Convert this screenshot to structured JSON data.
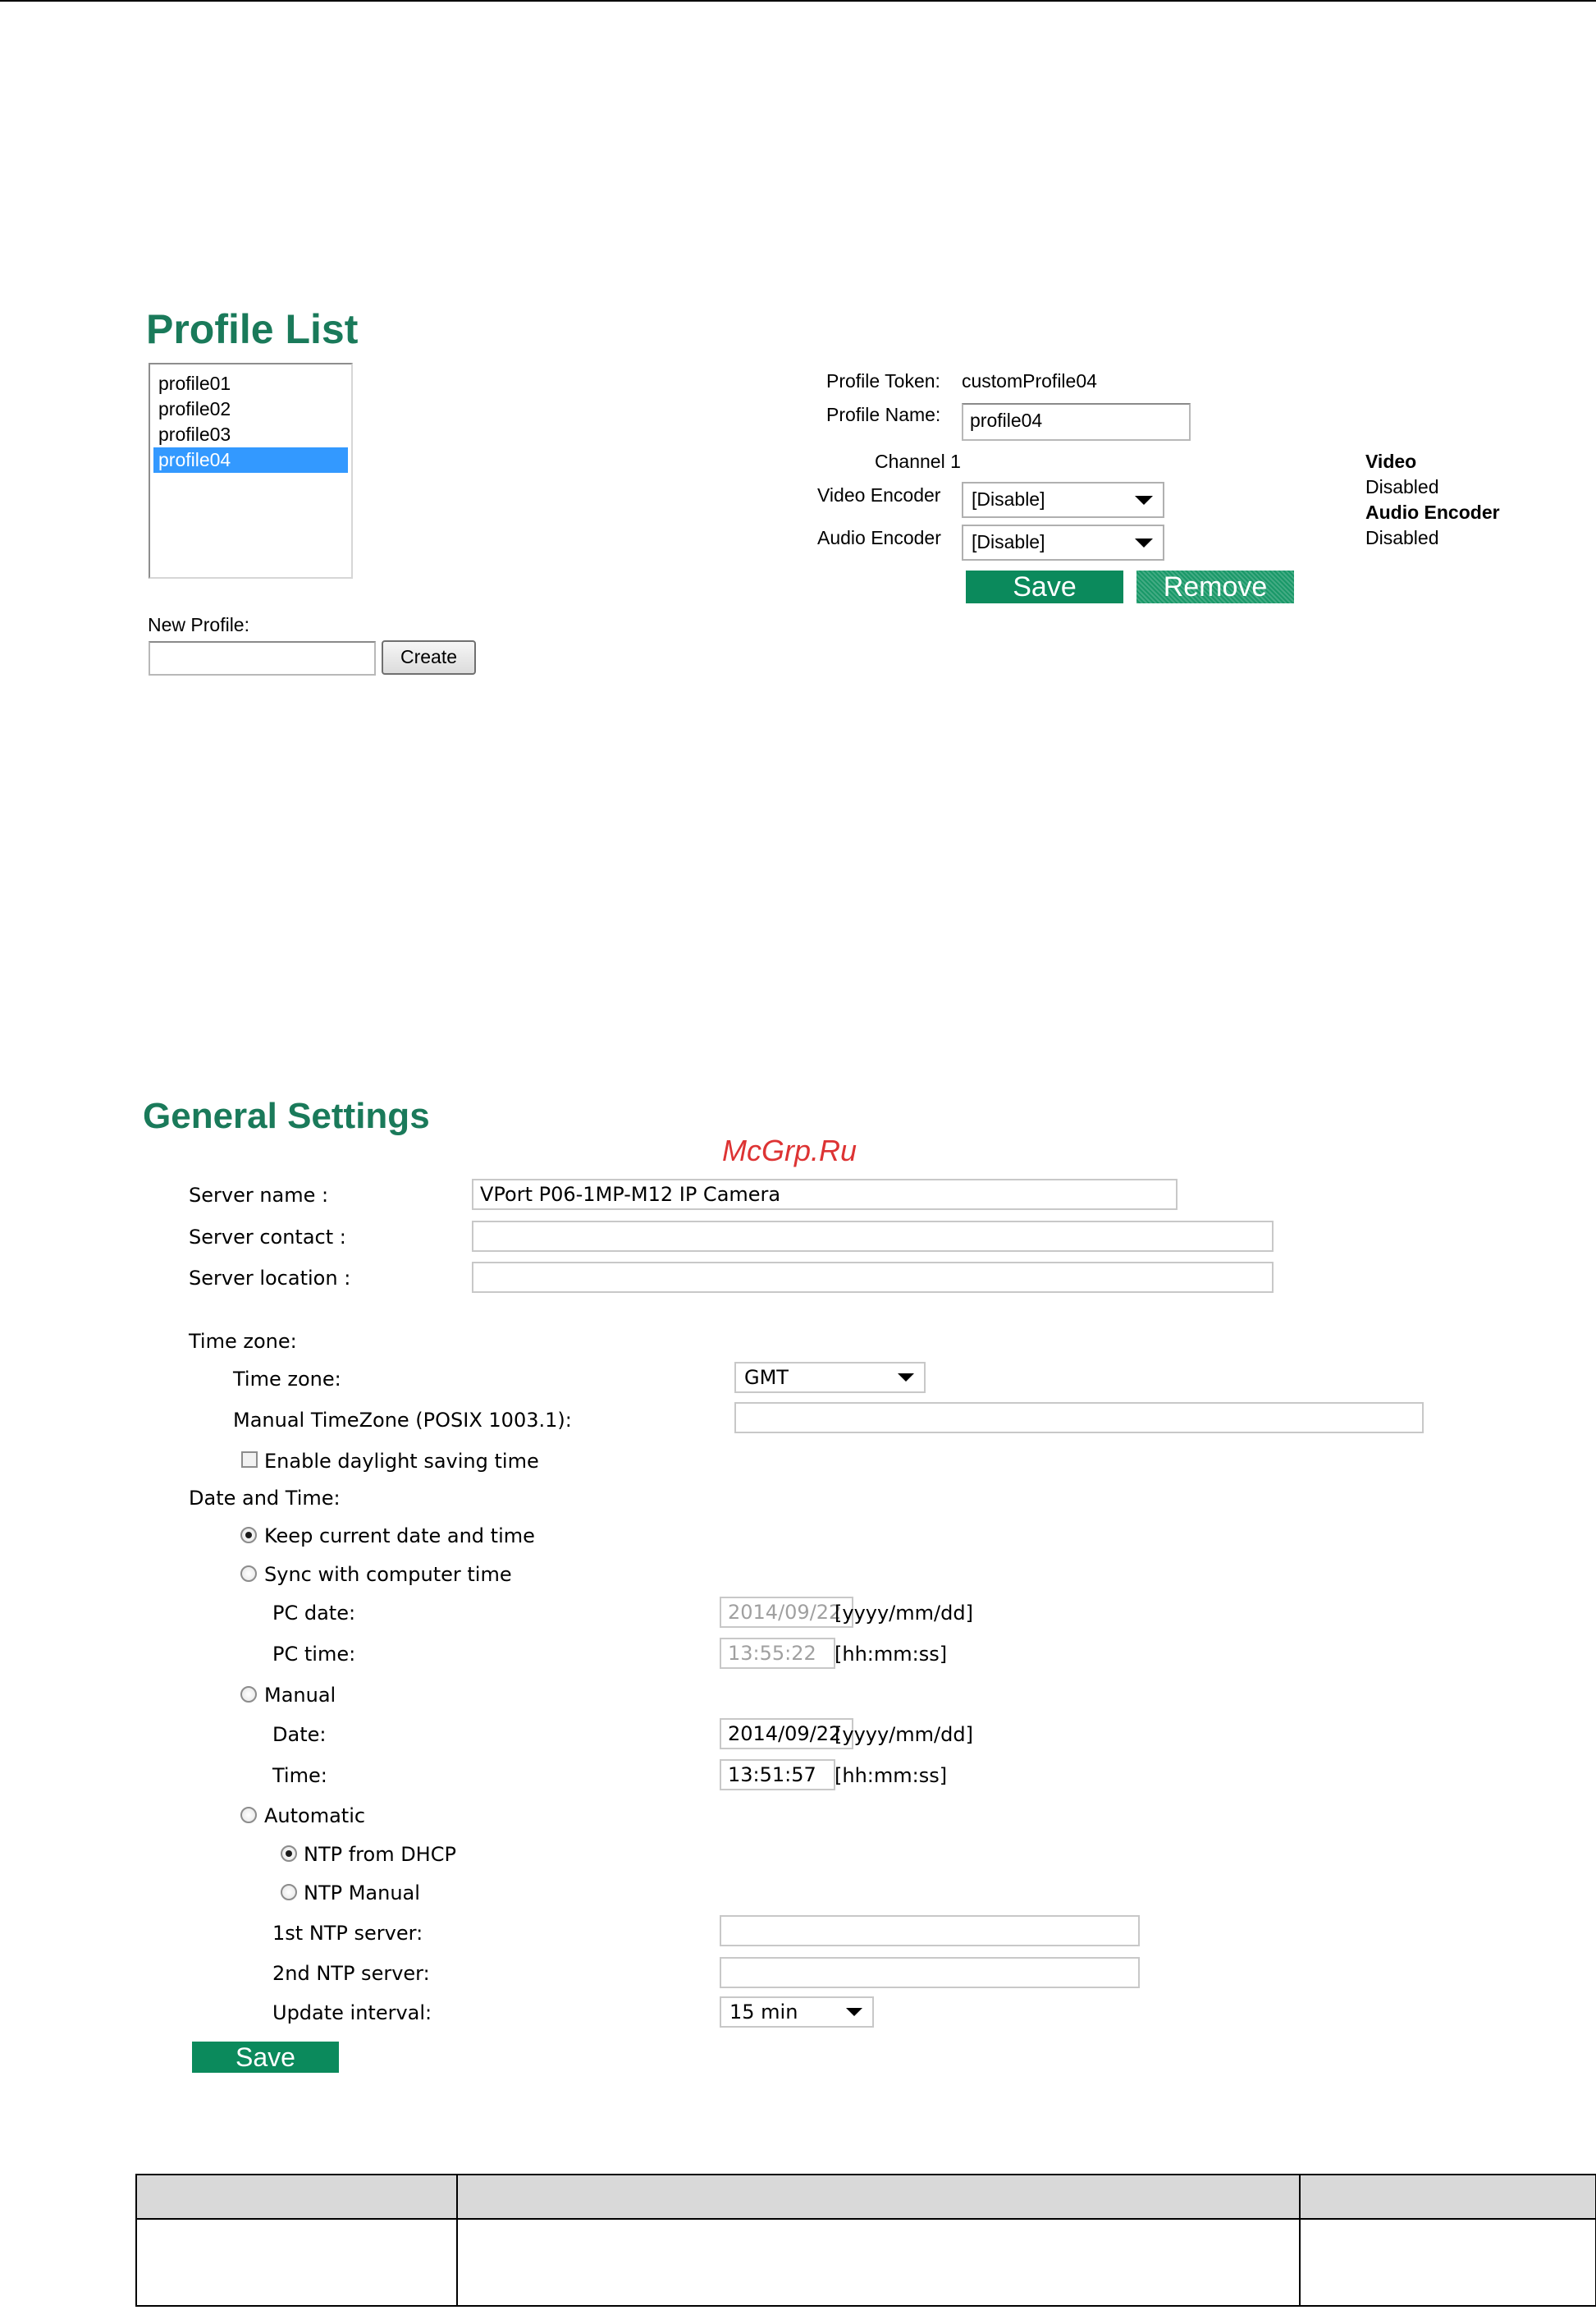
{
  "profile_section": {
    "title": "Profile List",
    "profiles": [
      "profile01",
      "profile02",
      "profile03",
      "profile04"
    ],
    "selected_profile": "profile04",
    "new_profile_label": "New Profile:",
    "new_profile_value": "",
    "create_label": "Create",
    "token_label": "Profile Token:",
    "token_value": "customProfile04",
    "name_label": "Profile Name:",
    "name_value": "profile04",
    "channel_label": "Channel 1",
    "video_encoder_label": "Video Encoder",
    "video_encoder_value": "[Disable]",
    "audio_encoder_label": "Audio Encoder",
    "audio_encoder_value": "[Disable]",
    "save_label": "Save",
    "remove_label": "Remove",
    "summary": {
      "video_heading": "Video",
      "video_value": "Disabled",
      "audio_heading": "Audio Encoder",
      "audio_value": "Disabled"
    }
  },
  "watermark": "McGrp.Ru",
  "general_settings": {
    "title": "General Settings",
    "server_name_label": "Server name :",
    "server_name_value": "VPort P06-1MP-M12 IP Camera",
    "server_contact_label": "Server contact :",
    "server_contact_value": "",
    "server_location_label": "Server location :",
    "server_location_value": "",
    "time_zone_heading": "Time zone:",
    "time_zone_label": "Time zone:",
    "time_zone_value": "GMT",
    "manual_tz_label": "Manual TimeZone (POSIX 1003.1):",
    "manual_tz_value": "",
    "dst_label": "Enable daylight saving time",
    "dst_checked": false,
    "date_time_heading": "Date and Time:",
    "keep_current_label": "Keep current date and time",
    "sync_label": "Sync with computer time",
    "pc_date_label": "PC date:",
    "pc_date_value": "2014/09/22",
    "pc_date_format": "[yyyy/mm/dd]",
    "pc_time_label": "PC time:",
    "pc_time_value": "13:55:22",
    "pc_time_format": "[hh:mm:ss]",
    "manual_label": "Manual",
    "date_label": "Date:",
    "date_value": "2014/09/22",
    "date_format": "[yyyy/mm/dd]",
    "time_label": "Time:",
    "time_value": "13:51:57",
    "time_format": "[hh:mm:ss]",
    "automatic_label": "Automatic",
    "ntp_dhcp_label": "NTP from DHCP",
    "ntp_manual_label": "NTP Manual",
    "ntp1_label": "1st NTP server:",
    "ntp1_value": "",
    "ntp2_label": "2nd NTP server:",
    "ntp2_value": "",
    "update_interval_label": "Update interval:",
    "update_interval_value": "15 min",
    "save_label": "Save"
  },
  "colors": {
    "heading_green": "#1a7a5a",
    "button_green": "#0b8a5c",
    "selection_blue": "#3399ff",
    "watermark_red": "#dd3333"
  }
}
